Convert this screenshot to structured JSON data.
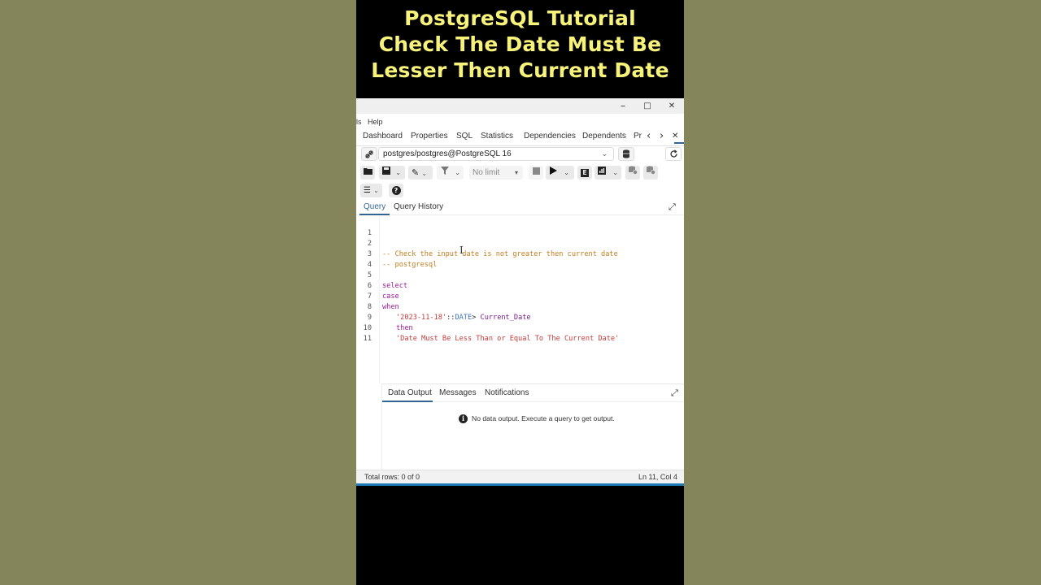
{
  "banner": {
    "line1": "PostgreSQL Tutorial",
    "line2": "Check The Date Must Be",
    "line3": "Lesser Then Current Date"
  },
  "window": {
    "minimize": "–",
    "maximize": "□",
    "close": "✕"
  },
  "menu": {
    "partial": "ls",
    "help": "Help"
  },
  "tabs": {
    "items": [
      "Dashboard",
      "Properties",
      "SQL",
      "Statistics",
      "Dependencies",
      "Dependents",
      "Pr"
    ],
    "prev": "‹",
    "next": "›",
    "close": "✕"
  },
  "connection": {
    "value": "postgres/postgres@PostgreSQL 16",
    "caret": "⌵"
  },
  "toolbar": {
    "limit_label": "No limit",
    "explain_label": "E",
    "help_label": "?"
  },
  "query_tabs": {
    "query": "Query",
    "history": "Query History"
  },
  "editor": {
    "line_numbers": [
      "1",
      "2",
      "3",
      "4",
      "5",
      "6",
      "7",
      "8",
      "9",
      "10",
      "11"
    ],
    "line2": "-- Check the input date is not greater then current date",
    "line3": "-- postgresql",
    "line5": "select",
    "line6": "case",
    "line7": "when",
    "line8_str": "'2023-11-18'",
    "line8_cast": "::",
    "line8_type": "DATE",
    "line8_op": "> ",
    "line8_ident": "Current_Date",
    "line9": "then",
    "line10": "'Date Must Be Less Than or Equal To The Current Date'"
  },
  "results": {
    "tabs": [
      "Data Output",
      "Messages",
      "Notifications"
    ],
    "empty_message": "No data output. Execute a query to get output."
  },
  "status": {
    "rows": "Total rows: 0 of 0",
    "position": "Ln 11, Col 4"
  },
  "colors": {
    "banner_text": "#f7f37a",
    "accent": "#326690",
    "comment": "#c47d1c",
    "keyword": "#a01a98",
    "string": "#c43a3a"
  }
}
